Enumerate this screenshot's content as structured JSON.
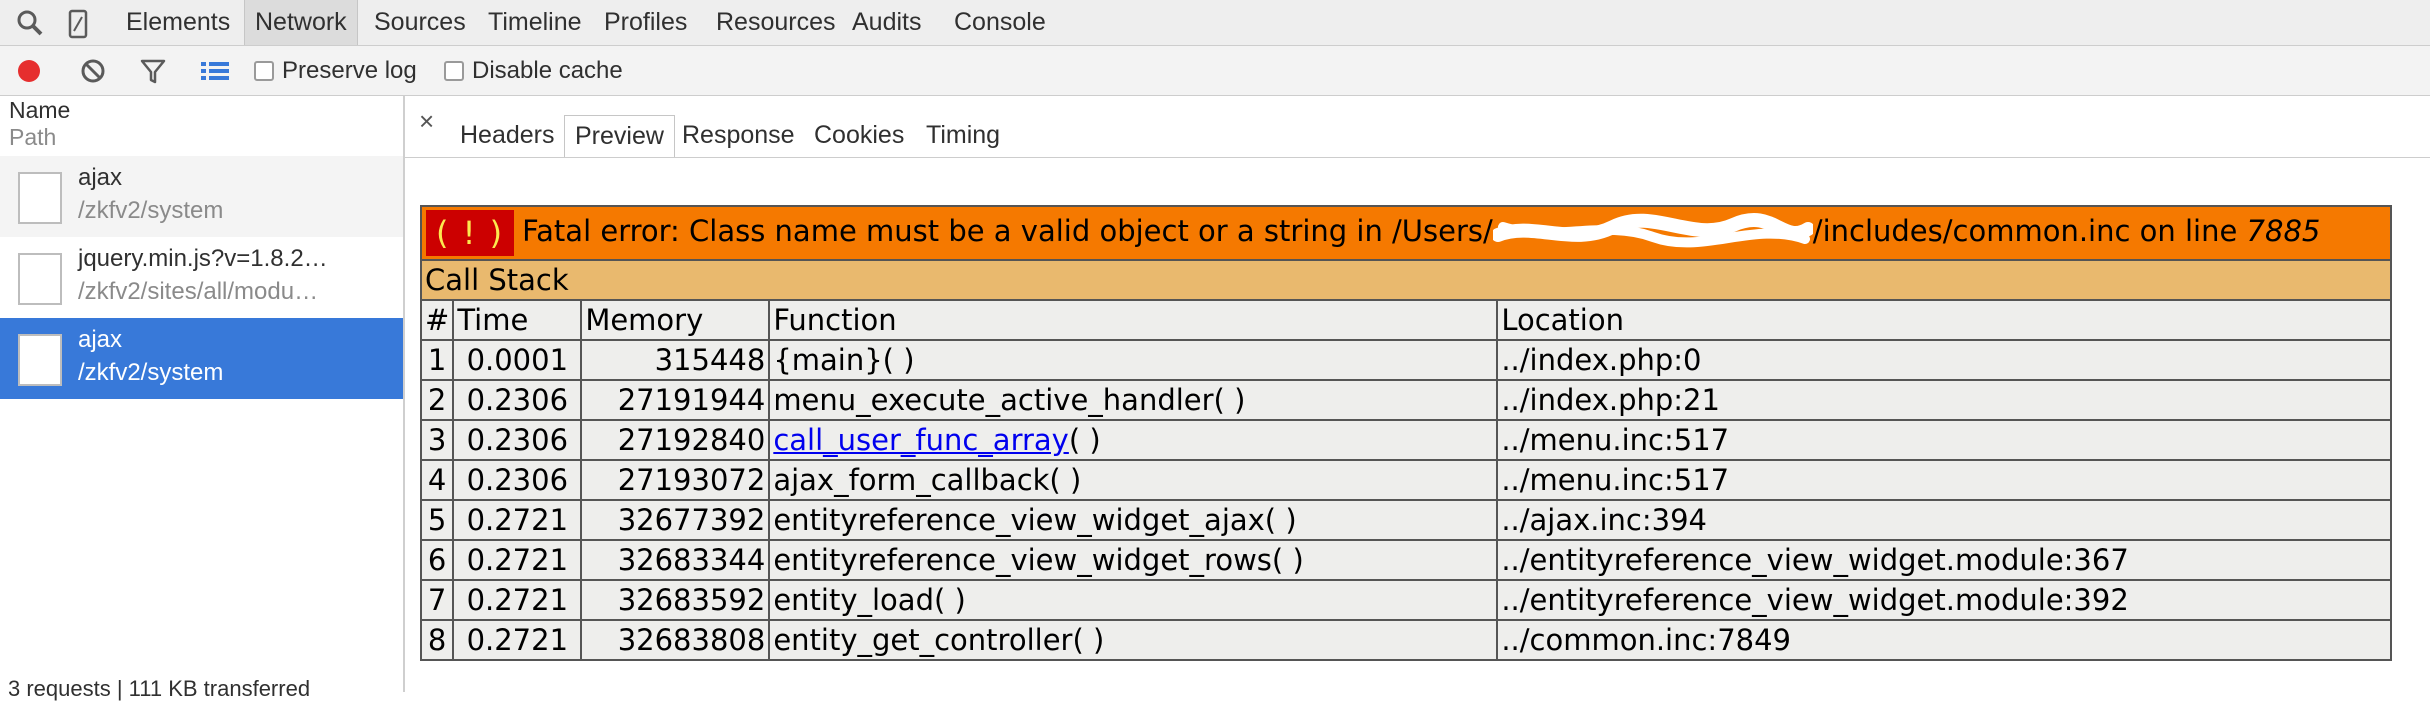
{
  "devtools": {
    "panels": [
      "Elements",
      "Network",
      "Sources",
      "Timeline",
      "Profiles",
      "Resources",
      "Audits",
      "Console"
    ],
    "selected_panel": "Network"
  },
  "toolbar": {
    "preserve_log": "Preserve log",
    "disable_cache": "Disable cache"
  },
  "request_list": {
    "header_name": "Name",
    "header_path": "Path",
    "requests": [
      {
        "name": "ajax",
        "path": "/zkfv2/system"
      },
      {
        "name": "jquery.min.js?v=1.8.2…",
        "path": "/zkfv2/sites/all/modu…"
      },
      {
        "name": "ajax",
        "path": "/zkfv2/system"
      }
    ],
    "status": "3 requests | 111 KB transferred"
  },
  "detail_tabs": {
    "close": "×",
    "tabs": [
      "Headers",
      "Preview",
      "Response",
      "Cookies",
      "Timing"
    ],
    "selected": "Preview"
  },
  "preview": {
    "error_icon": "( ! )",
    "error_prefix": "Fatal error: Class name must be a valid object or a string in /Users/",
    "error_suffix": "/includes/common.inc on line ",
    "error_line": "7885",
    "stack_title": "Call Stack",
    "columns": [
      "#",
      "Time",
      "Memory",
      "Function",
      "Location"
    ],
    "rows": [
      {
        "n": "1",
        "time": "0.0001",
        "memory": "315448",
        "func": "{main}( )",
        "link": "",
        "link_rest": "",
        "location": "../index.php:0"
      },
      {
        "n": "2",
        "time": "0.2306",
        "memory": "27191944",
        "func": "menu_execute_active_handler( )",
        "link": "",
        "link_rest": "",
        "location": "../index.php:21"
      },
      {
        "n": "3",
        "time": "0.2306",
        "memory": "27192840",
        "func": "",
        "link": "call_user_func_array",
        "link_rest": "( )",
        "location": "../menu.inc:517"
      },
      {
        "n": "4",
        "time": "0.2306",
        "memory": "27193072",
        "func": "ajax_form_callback( )",
        "link": "",
        "link_rest": "",
        "location": "../menu.inc:517"
      },
      {
        "n": "5",
        "time": "0.2721",
        "memory": "32677392",
        "func": "entityreference_view_widget_ajax( )",
        "link": "",
        "link_rest": "",
        "location": "../ajax.inc:394"
      },
      {
        "n": "6",
        "time": "0.2721",
        "memory": "32683344",
        "func": "entityreference_view_widget_rows( )",
        "link": "",
        "link_rest": "",
        "location": "../entityreference_view_widget.module:367"
      },
      {
        "n": "7",
        "time": "0.2721",
        "memory": "32683592",
        "func": "entity_load( )",
        "link": "",
        "link_rest": "",
        "location": "../entityreference_view_widget.module:392"
      },
      {
        "n": "8",
        "time": "0.2721",
        "memory": "32683808",
        "func": "entity_get_controller( )",
        "link": "",
        "link_rest": "",
        "location": "../common.inc:7849"
      }
    ]
  },
  "colors": {
    "error_bg": "#f57900",
    "stack_bg": "#e9b96e",
    "row_bg": "#eeeeec",
    "selected_row": "#3879d9",
    "record": "#e62e2e"
  },
  "icons": [
    "search-icon",
    "device-mode-icon",
    "record-icon",
    "clear-icon",
    "filter-icon",
    "list-view-icon",
    "document-icon"
  ]
}
